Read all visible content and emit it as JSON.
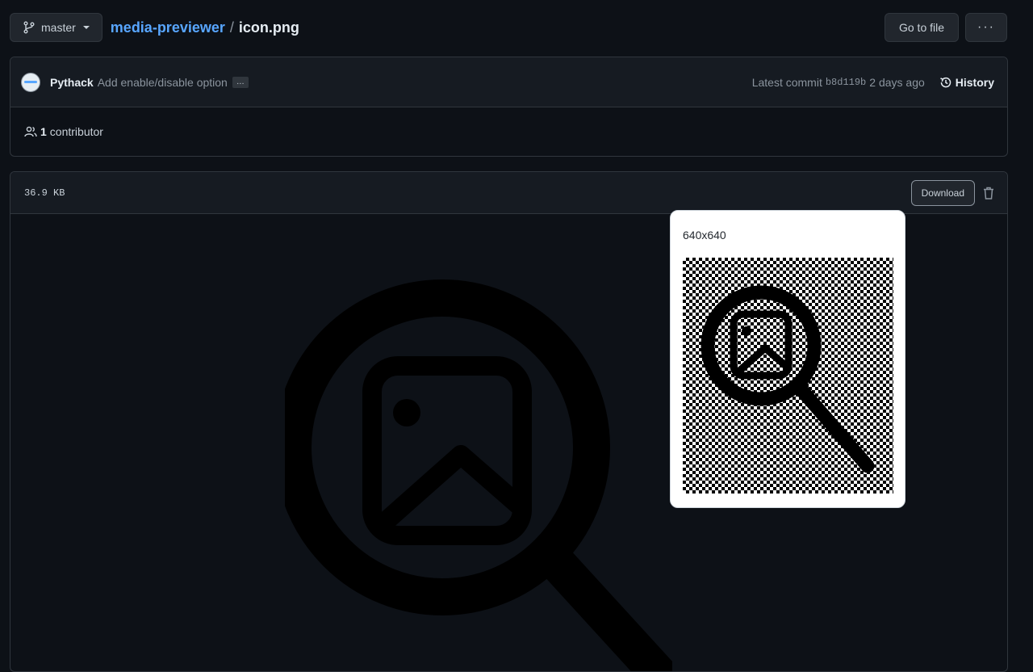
{
  "branch": {
    "name": "master"
  },
  "breadcrumb": {
    "repo": "media-previewer",
    "separator": "/",
    "file": "icon.png"
  },
  "actions": {
    "go_to_file": "Go to file",
    "more": "···"
  },
  "commit": {
    "author": "Pythack",
    "message": "Add enable/disable option",
    "ellipsis": "…",
    "latest_label": "Latest commit",
    "sha": "b8d119b",
    "time": "2 days ago",
    "history_label": "History"
  },
  "contributors": {
    "count": "1",
    "label": "contributor"
  },
  "file": {
    "size": "36.9 KB",
    "download_label": "Download"
  },
  "popup": {
    "dimensions": "640x640"
  },
  "colors": {
    "bg": "#0d1117",
    "panel": "#161b22",
    "border": "#30363d",
    "link": "#58a6ff"
  }
}
